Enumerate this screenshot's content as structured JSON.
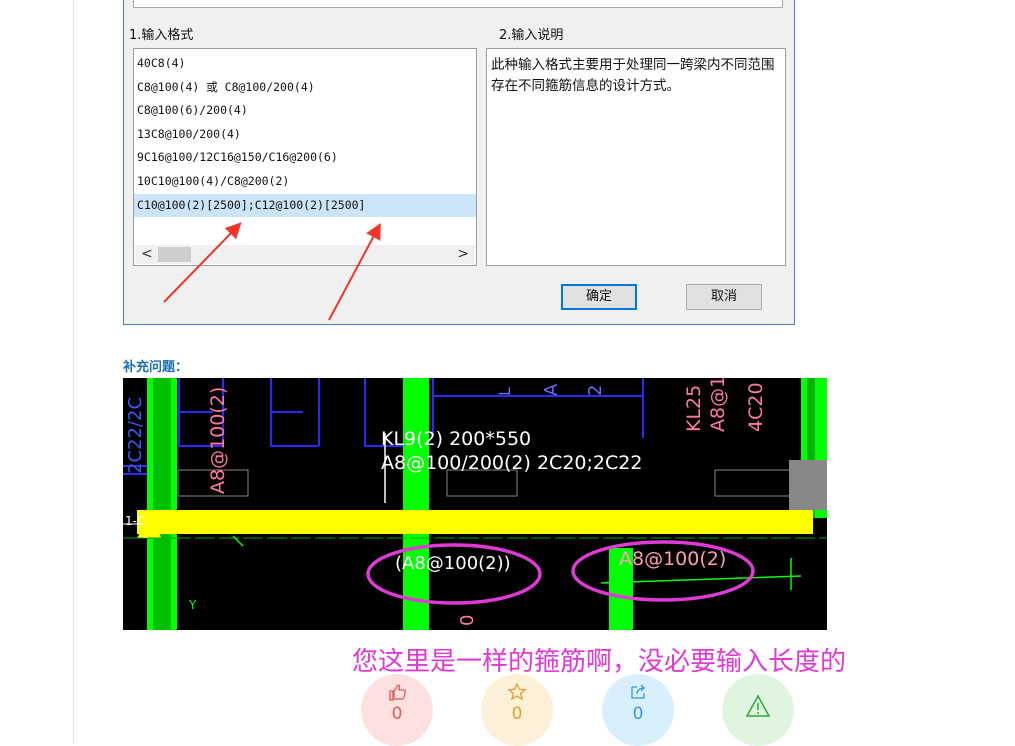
{
  "dialog": {
    "section1_title": "1.输入格式",
    "section2_title": "2.输入说明",
    "format_items": [
      "40C8(4)",
      "C8@100(4) 或 C8@100/200(4)",
      "C8@100(6)/200(4)",
      "13C8@100/200(4)",
      "9C16@100/12C16@150/C16@200(6)",
      "10C10@100(4)/C8@200(2)",
      "C10@100(2)[2500];C12@100(2)[2500]"
    ],
    "selected_index": 6,
    "description": "此种输入格式主要用于处理同一跨梁内不同范围存在不同箍筋信息的设计方式。",
    "scroll_left": "<",
    "scroll_right": ">",
    "ok_label": "确定",
    "cancel_label": "取消"
  },
  "supplement": {
    "label": "补充问题："
  },
  "cad": {
    "beam_title": "KL9(2)  200*550",
    "beam_rebar": "A8@100/200(2)  2C20;2C22",
    "left_vertical": "2C22/2C",
    "left_stirrup": "A8@100(2)",
    "right_beam": "KL25",
    "right_stirrup": "A8@1",
    "right_rebar": "4C20",
    "top_small_a": "A",
    "top_small_b": "2",
    "top_small_l": "L",
    "axis_label": "1-C",
    "y_label": "Y",
    "bottom_zero": "0",
    "circled_left": "(A8@100(2))",
    "circled_right": "A8@100(2)"
  },
  "comment_text": "您这里是一样的箍筋啊，没必要输入长度的",
  "actions": [
    {
      "name": "like",
      "icon": "👍",
      "count": "0",
      "bg": "#fde0e0",
      "fg": "#e05a5a"
    },
    {
      "name": "favorite",
      "icon": "☆",
      "count": "0",
      "bg": "#fdf0d8",
      "fg": "#e0a030"
    },
    {
      "name": "share",
      "icon": "↗",
      "count": "0",
      "bg": "#d8effc",
      "fg": "#3a9ad9"
    },
    {
      "name": "report",
      "icon": "⚠",
      "count": "",
      "bg": "#dff5df",
      "fg": "#2fa83a"
    }
  ],
  "colors": {
    "magenta": "#e03ad6",
    "cad_green": "#00ff00",
    "cad_yellow": "#ffff00",
    "cad_blue": "#1a1aff",
    "arrow_red": "#f0352a"
  }
}
